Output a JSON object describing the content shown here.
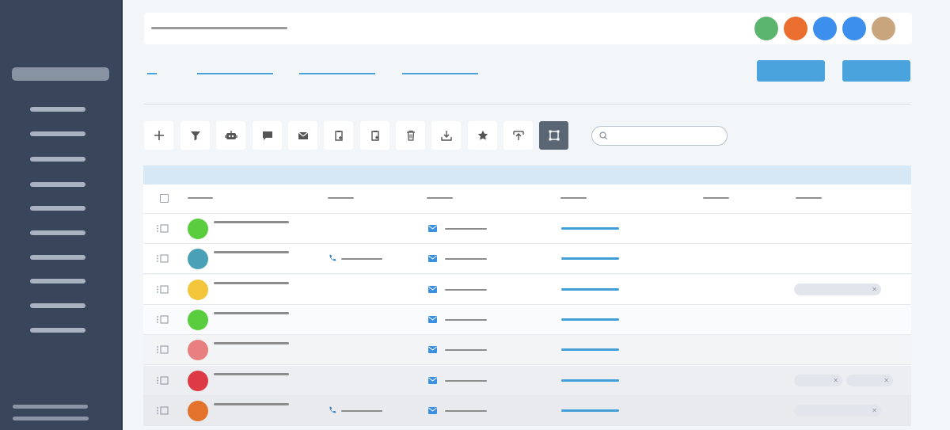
{
  "colors": {
    "sidebar": "#39455a",
    "accent": "#4aa3dc",
    "link": "#3f9fd6",
    "header_band": "#d6e8f5"
  },
  "topbar": {
    "avatars": [
      "#5cb56e",
      "#ea6f2e",
      "#3d8fee",
      "#3d8fee",
      "#c9a57d"
    ]
  },
  "toolbar": {
    "icons": [
      "plus-icon",
      "filter-icon",
      "robot-icon",
      "chat-icon",
      "mail-icon",
      "clipboard-add-icon",
      "clipboard-star-icon",
      "trash-icon",
      "download-icon",
      "star-icon",
      "upload-icon",
      "select-frame-icon"
    ]
  },
  "rows": [
    {
      "avatar_color": "#5acd3f",
      "phone": false,
      "tags": 0
    },
    {
      "avatar_color": "#4aa0b6",
      "phone": true,
      "tags": 0
    },
    {
      "avatar_color": "#f2c53b",
      "phone": false,
      "tags": 1
    },
    {
      "avatar_color": "#5acd3f",
      "phone": false,
      "tags": 0
    },
    {
      "avatar_color": "#e98080",
      "phone": false,
      "tags": 0
    },
    {
      "avatar_color": "#de3a46",
      "phone": false,
      "tags": 2
    },
    {
      "avatar_color": "#e2722c",
      "phone": true,
      "tags": 1
    }
  ]
}
